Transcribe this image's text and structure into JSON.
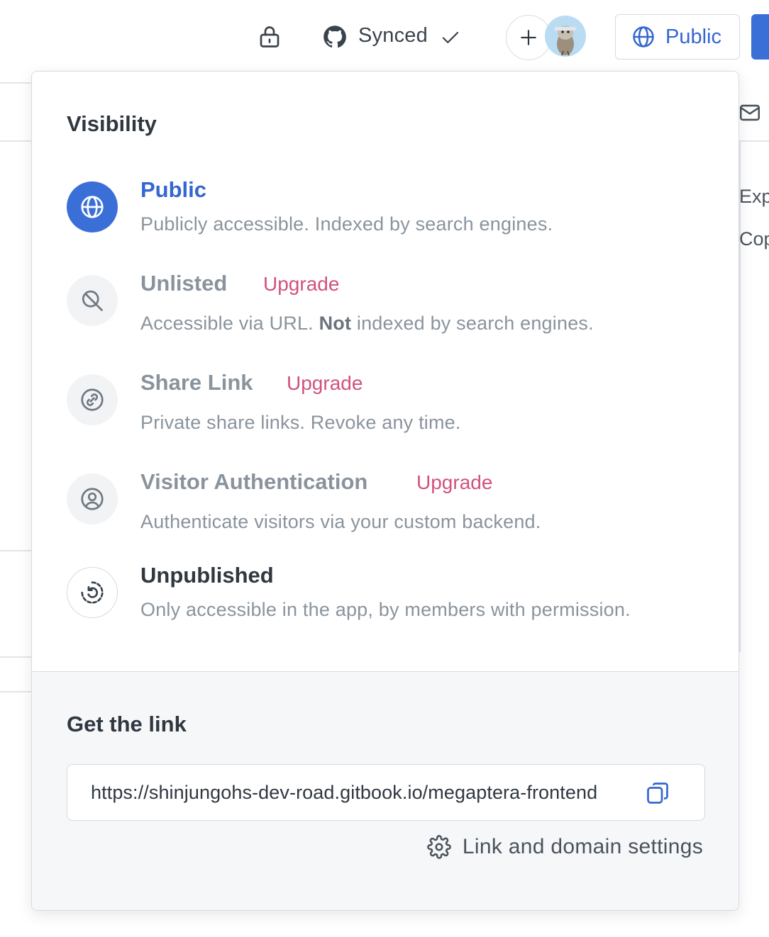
{
  "topbar": {
    "lock_icon": "lock-icon",
    "sync_status": "Synced",
    "visibility_button_label": "Public",
    "accent_color": "#3b6fd8"
  },
  "background": {
    "partial_texts": [
      "Exp",
      "Cop"
    ]
  },
  "visibility_panel": {
    "title": "Visibility",
    "options": [
      {
        "key": "public",
        "title": "Public",
        "description": "Publicly accessible. Indexed by search engines.",
        "selected": true,
        "icon": "globe-icon"
      },
      {
        "key": "unlisted",
        "title": "Unlisted",
        "upgrade": "Upgrade",
        "description_pre": "Accessible via URL. ",
        "description_bold": "Not",
        "description_post": " indexed by search engines.",
        "icon": "search-slash-icon"
      },
      {
        "key": "share-link",
        "title": "Share Link",
        "upgrade": "Upgrade",
        "description": "Private share links. Revoke any time.",
        "icon": "link-icon"
      },
      {
        "key": "visitor-auth",
        "title": "Visitor Authentication",
        "upgrade": "Upgrade",
        "description": "Authenticate visitors via your custom backend.",
        "icon": "user-circle-icon"
      },
      {
        "key": "unpublished",
        "title": "Unpublished",
        "description": "Only accessible in the app, by members with permission.",
        "icon": "revert-icon"
      }
    ],
    "upgrade_color": "#d1527a"
  },
  "get_link": {
    "title": "Get the link",
    "url": "https://shinjungohs-dev-road.gitbook.io/megaptera-frontend",
    "settings_label": "Link and domain settings"
  }
}
